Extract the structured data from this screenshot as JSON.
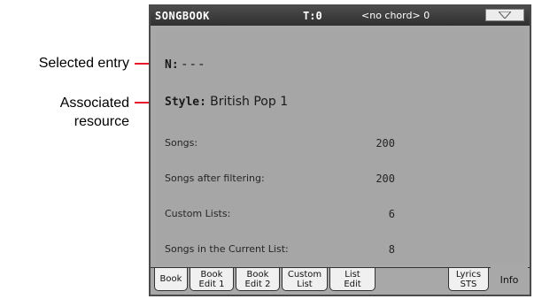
{
  "callouts": {
    "selected_entry": "Selected entry",
    "associated_resource_1": "Associated",
    "associated_resource_2": "resource"
  },
  "titlebar": {
    "title": "SONGBOOK",
    "tempo": "T:0",
    "chord": "<no chord> 0",
    "menu_icon": "chevron-down-icon"
  },
  "entry": {
    "number_label": "N:",
    "number_value": "- - -",
    "style_label": "Style:",
    "style_value": "British Pop 1"
  },
  "stats": [
    {
      "label": "Songs:",
      "value": "200"
    },
    {
      "label": "Songs after filtering:",
      "value": "200"
    },
    {
      "label": "Custom Lists:",
      "value": "6"
    },
    {
      "label": "Songs in the Current List:",
      "value": "8"
    }
  ],
  "tabs": [
    {
      "line1": "Book",
      "line2": ""
    },
    {
      "line1": "Book",
      "line2": "Edit 1"
    },
    {
      "line1": "Book",
      "line2": "Edit 2"
    },
    {
      "line1": "Custom",
      "line2": "List"
    },
    {
      "line1": "List",
      "line2": "Edit"
    },
    {
      "line1": "Lyrics",
      "line2": "STS"
    },
    {
      "line1": "Info",
      "line2": ""
    }
  ],
  "colors": {
    "callout": "#e8182a",
    "screen_bg": "#a8a8a8",
    "titlebar": "#3a3a3a"
  }
}
